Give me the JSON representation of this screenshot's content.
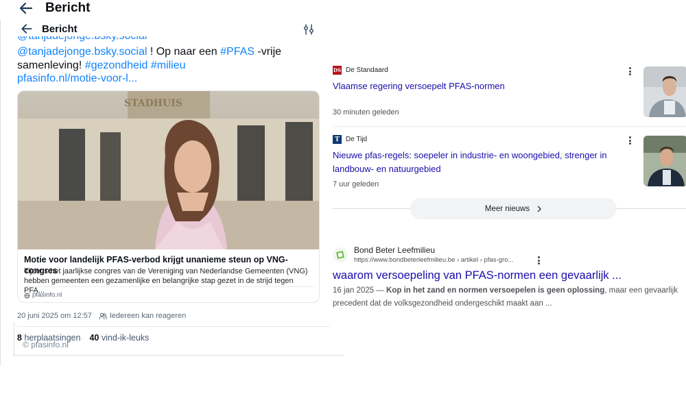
{
  "outer_header": {
    "title": "Bericht"
  },
  "inner_header": {
    "title": "Bericht"
  },
  "post": {
    "clipped_first_line": "@tanjadejonge.bsky.social",
    "mention": "@tanjadejonge.bsky.social",
    "text_1": " ! Op naar een ",
    "hashtag_pfas": "#PFAS",
    "text_2": " -vrije samenleving! ",
    "hashtag_gezondheid": "#gezondheid",
    "hashtag_milieu": "#milieu",
    "link": "pfasinfo.nl/motie-voor-l...",
    "card": {
      "title": "Motie voor landelijk PFAS-verbod krijgt unanieme steun op VNG-congres",
      "description": "Tijdens het jaarlijkse congres van de Vereniging van Nederlandse Gemeenten (VNG) hebben gemeenten een gezamenlijke en belangrijke stap gezet in de strijd tegen PFA...",
      "domain": "pfasinfo.nl"
    },
    "timestamp": "20 juni 2025 om 12:57",
    "reply_setting": "Iedereen kan reageren",
    "reposts_count": "8",
    "reposts_label": "herplaatsingen",
    "likes_count": "40",
    "likes_label": "vind-ik-leuks",
    "ghost_domain": "pfasinfo.nl"
  },
  "news": [
    {
      "source": "De Standaard",
      "logo_text": "DS",
      "headline": "Vlaamse regering versoepelt PFAS-normen",
      "time": "30 minuten geleden"
    },
    {
      "source": "De Tijd",
      "logo_text": "T",
      "headline": "Nieuwe pfas-regels: soepeler in industrie- en woongebied, strenger in landbouw- en natuurgebied",
      "time": "7 uur geleden"
    }
  ],
  "more_news": {
    "label": "Meer nieuws"
  },
  "result": {
    "site_name": "Bond Beter Leefmilieu",
    "url": "https://www.bondbeterleefmilieu.be › artikel › pfas-gro...",
    "title": "waarom versoepeling van PFAS-normen een gevaarlijk ...",
    "date": "16 jan 2025",
    "snippet_sep": " — ",
    "snippet_bold": "Kop in het zand en normen versoepelen is geen oplossing",
    "snippet_rest": ", maar een gevaarlijk precedent dat de volksgezondheid ondergeschikt maakt aan ..."
  },
  "colors": {
    "bluesky_link": "#1083fe",
    "google_link": "#1a0dab",
    "ds_red": "#b5121b",
    "tijd_blue": "#0e3a6e"
  }
}
